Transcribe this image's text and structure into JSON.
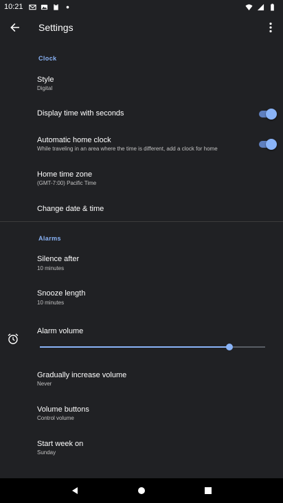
{
  "status_bar": {
    "time": "10:21",
    "notification_icons": [
      "gmail-icon",
      "photos-icon",
      "clipboard-icon",
      "dot-icon"
    ],
    "right_icons": [
      "wifi-icon",
      "signal-icon",
      "battery-icon"
    ]
  },
  "toolbar": {
    "title": "Settings",
    "back_icon": "back-arrow-icon",
    "overflow_icon": "more-vert-icon"
  },
  "sections": {
    "clock": {
      "header": "Clock",
      "style": {
        "title": "Style",
        "summary": "Digital"
      },
      "display_seconds": {
        "title": "Display time with seconds",
        "checked": true
      },
      "auto_home_clock": {
        "title": "Automatic home clock",
        "summary": "While traveling in an area where the time is different, add a clock for home",
        "checked": true
      },
      "home_time_zone": {
        "title": "Home time zone",
        "summary": "(GMT-7:00) Pacific Time"
      },
      "change_date_time": {
        "title": "Change date & time"
      }
    },
    "alarms": {
      "header": "Alarms",
      "silence_after": {
        "title": "Silence after",
        "summary": "10 minutes"
      },
      "snooze_length": {
        "title": "Snooze length",
        "summary": "10 minutes"
      },
      "alarm_volume": {
        "title": "Alarm volume",
        "value_fraction": 0.84,
        "icon": "alarm-clock-icon"
      },
      "gradually_increase": {
        "title": "Gradually increase volume",
        "summary": "Never"
      },
      "volume_buttons": {
        "title": "Volume buttons",
        "summary": "Control volume"
      },
      "start_week_on": {
        "title": "Start week on",
        "summary": "Sunday"
      }
    }
  },
  "nav_bar": {
    "back_icon": "nav-back-icon",
    "home_icon": "nav-home-icon",
    "recents_icon": "nav-recents-icon"
  },
  "colors": {
    "background": "#202124",
    "accent": "#8ab4f8",
    "switch_track": "#5e7fbf",
    "secondary_text": "#c2c2c2"
  }
}
